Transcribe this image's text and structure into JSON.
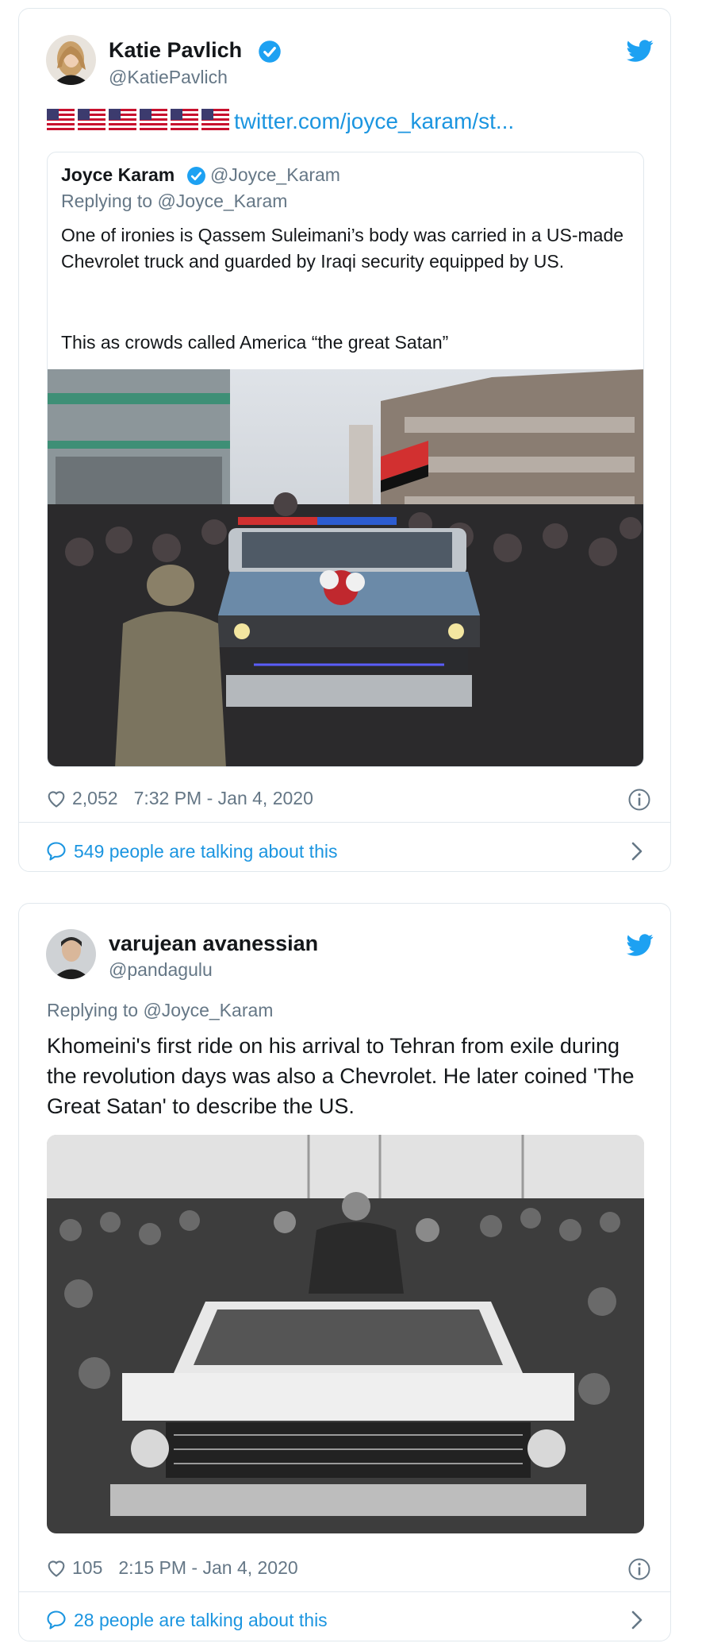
{
  "tweet1": {
    "author_name": "Katie Pavlich",
    "author_handle": "@KatiePavlich",
    "flags": [
      "us-flag",
      "us-flag",
      "us-flag",
      "us-flag",
      "us-flag",
      "us-flag"
    ],
    "link": "twitter.com/joyce_karam/st...",
    "quoted": {
      "author_name": "Joyce Karam",
      "author_handle": "@Joyce_Karam",
      "replying_to": "Replying to @Joyce_Karam",
      "text": "One of ironies is Qassem Suleimani’s body was carried in a US-made Chevrolet truck and guarded by Iraqi security equipped by US.",
      "text2": "This as crowds called America “the great Satan”"
    },
    "likes": "2,052",
    "timestamp": "7:32 PM - Jan 4, 2020",
    "talking": "549 people are talking about this"
  },
  "tweet2": {
    "author_name": "varujean avanessian",
    "author_handle": "@pandagulu",
    "replying_to": "Replying to @Joyce_Karam",
    "text": "Khomeini's first ride on his arrival to Tehran from exile during the revolution days was also a Chevrolet. He later coined 'The Great Satan' to describe the US.",
    "likes": "105",
    "timestamp": "2:15 PM - Jan 4, 2020",
    "talking": "28 people are talking about this"
  },
  "colors": {
    "accent": "#1b95e0",
    "muted": "#657786",
    "border": "#e1e8ed",
    "verified": "#1da1f2",
    "text": "#14171a"
  },
  "icons": [
    "verified-badge-icon",
    "twitter-bird-icon",
    "heart-icon",
    "info-icon",
    "comment-bubble-icon",
    "chevron-right-icon"
  ]
}
